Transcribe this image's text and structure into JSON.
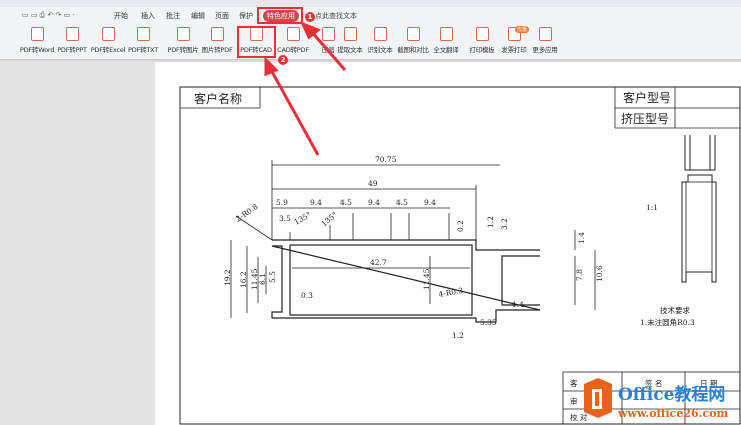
{
  "menubar": {
    "items": [
      "开始",
      "插入",
      "批注",
      "编辑",
      "页面",
      "保护",
      "特色应用"
    ],
    "active": "特色应用",
    "search": "点此查找文本"
  },
  "ribbon": {
    "items": [
      "PDF转Word",
      "PDF转PPT",
      "PDF转Excel",
      "PDF转TXT",
      "PDF转图片",
      "图片转PDF",
      "PDF转CAD",
      "CAD转PDF",
      "压缩",
      "提取文本",
      "识别文本",
      "截图和对比",
      "全文翻译",
      "打印模板",
      "发票打印",
      "更多应用"
    ],
    "invoice_badge": "优惠"
  },
  "annotations": {
    "step1": "1",
    "step2": "2",
    "color": "#e8303a"
  },
  "drawing": {
    "customer_name": "客户名称",
    "customer_model": "客户型号",
    "extrusion_model": "挤压型号",
    "dims": {
      "d7075": "70.75",
      "d49": "49",
      "d59": "5.9",
      "d94a": "9.4",
      "d45a": "4.5",
      "d94b": "9.4",
      "d45b": "4.5",
      "d94c": "9.4",
      "r08": "2-R0.8",
      "d35": "3.5",
      "a135a": "135°",
      "a135b": "135°",
      "d02": "0.2",
      "d12a": "1.2",
      "d32": "3.2",
      "d192": "19.2",
      "d162": "16.2",
      "d1145a": "11.45",
      "d61": "6.1",
      "d55": "5.5",
      "d427": "42.7",
      "d03": "0.3",
      "d1145b": "11.45",
      "r03": "4-R0.3",
      "d14a": "1.4",
      "d535": "5.35",
      "d12b": "1.2",
      "d14b": "1.4",
      "d78": "7.8",
      "d106": "10.6"
    },
    "scale": "1:1",
    "tech_title": "技术要求",
    "tech_note": "1.未注圆角R0.3",
    "table": {
      "c1": "客",
      "c2": "签  名",
      "c3": "日  期",
      "c4": "审",
      "c5": "校    对"
    }
  },
  "watermark": {
    "name": "Office教程网",
    "url": "www.office26.com"
  }
}
